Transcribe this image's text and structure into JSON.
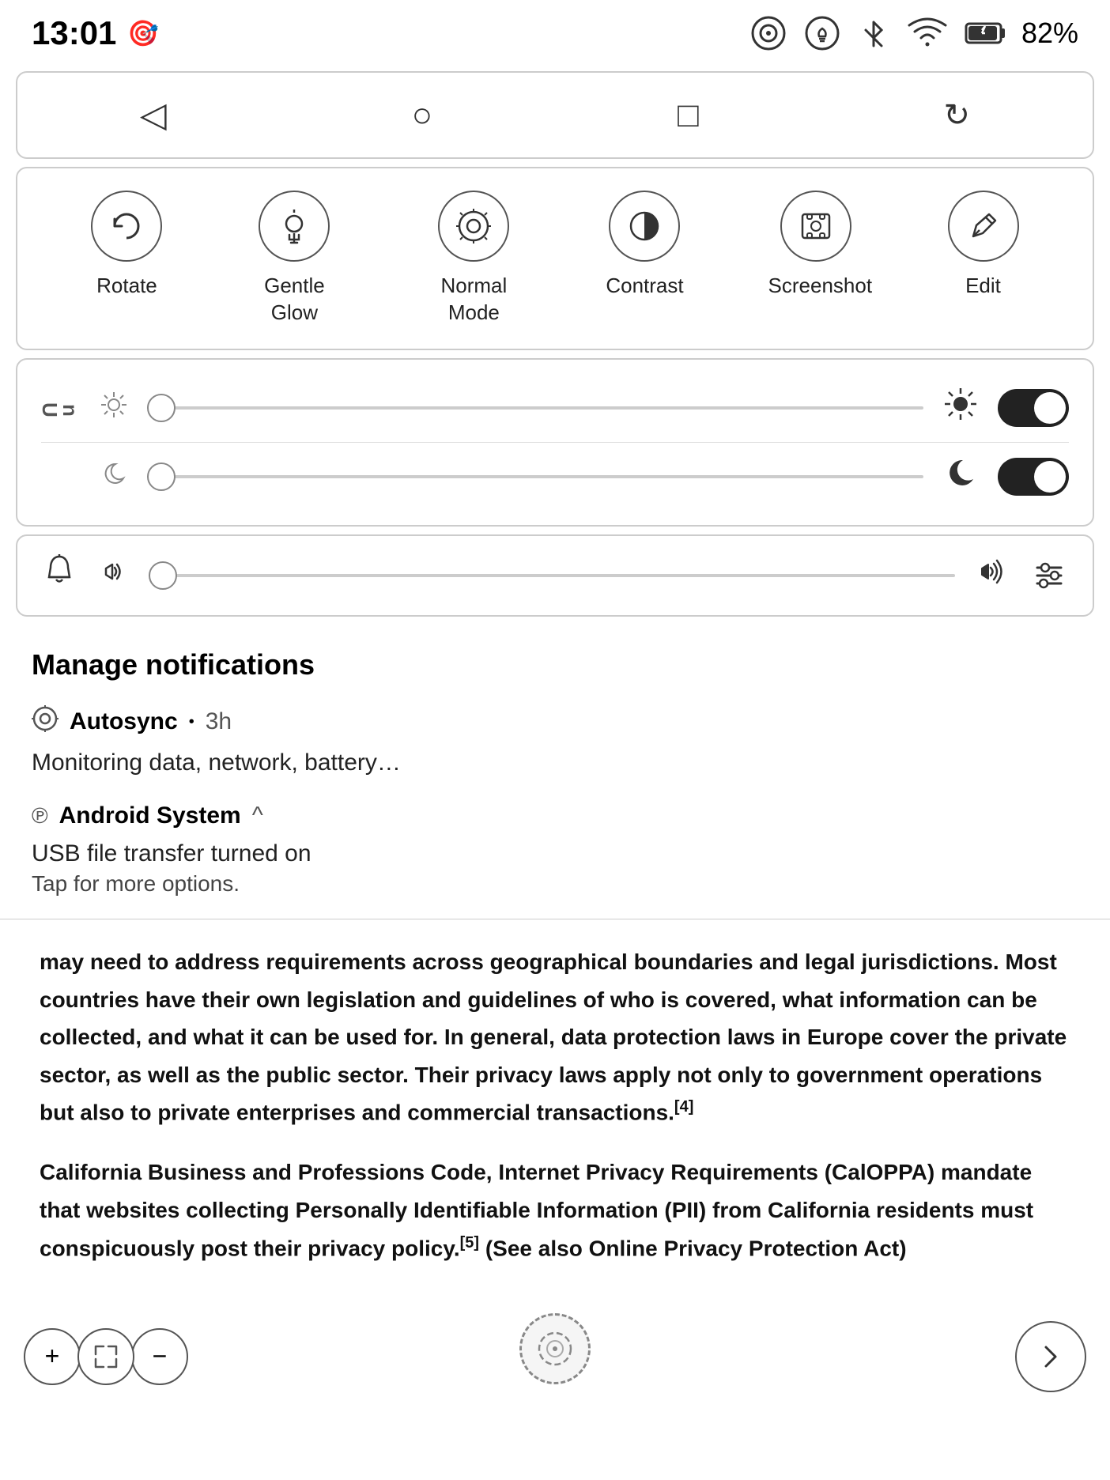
{
  "statusBar": {
    "time": "13:01",
    "batteryPercent": "82%"
  },
  "navBar": {
    "back": "◁",
    "home": "○",
    "recents": "□",
    "refresh": "↻"
  },
  "quickSettings": {
    "items": [
      {
        "id": "rotate",
        "label": "Rotate",
        "icon": "⟳",
        "active": false
      },
      {
        "id": "gentle-glow",
        "label": "Gentle Glow",
        "icon": "💡",
        "active": false
      },
      {
        "id": "normal-mode",
        "label": "Normal Mode",
        "icon": "⊙",
        "active": false
      },
      {
        "id": "contrast",
        "label": "Contrast",
        "icon": "◑",
        "active": false
      },
      {
        "id": "screenshot",
        "label": "Screenshot",
        "icon": "⊡",
        "active": false
      },
      {
        "id": "edit",
        "label": "Edit",
        "icon": "✏",
        "active": false
      }
    ]
  },
  "brightnessPanel": {
    "sliders": [
      {
        "id": "brightness",
        "value": 0,
        "label": "brightness"
      },
      {
        "id": "night-mode",
        "value": 0,
        "label": "night mode"
      }
    ],
    "toggles": [
      {
        "id": "brightness-toggle",
        "on": true
      },
      {
        "id": "night-toggle",
        "on": true
      }
    ]
  },
  "volumePanel": {
    "sliderValue": 0
  },
  "manageNotifications": {
    "title": "Manage notifications",
    "items": [
      {
        "id": "autosync",
        "icon": "⊙",
        "app": "Autosync",
        "dot": "•",
        "time": "3h",
        "body": "Monitoring data, network, battery…"
      },
      {
        "id": "android-system",
        "icon": "℗",
        "app": "Android System",
        "caret": "^",
        "body1": "USB file transfer turned on",
        "body2": "Tap for more options."
      }
    ]
  },
  "article": {
    "paragraphs": [
      "may need to address requirements across geographical boundaries and legal jurisdictions. Most countries have their own legislation and guidelines of who is covered, what information can be collected, and what it can be used for. In general, data protection laws in Europe cover the private sector, as well as the public sector. Their privacy laws apply not only to government operations but also to private enterprises and commercial transactions.",
      "California Business and Professions Code, Internet Privacy Requirements (CalOPPA) mandate that websites collecting Personally Identifiable Information (PII) from California residents must conspicuously post their privacy policy. (See also Online Privacy Protection Act)"
    ],
    "footnotes": [
      "[4]",
      "[5]"
    ]
  },
  "bottomBar": {
    "plusLabel": "+",
    "expandLabel": "⤢",
    "minusLabel": "−",
    "forwardLabel": "›"
  }
}
